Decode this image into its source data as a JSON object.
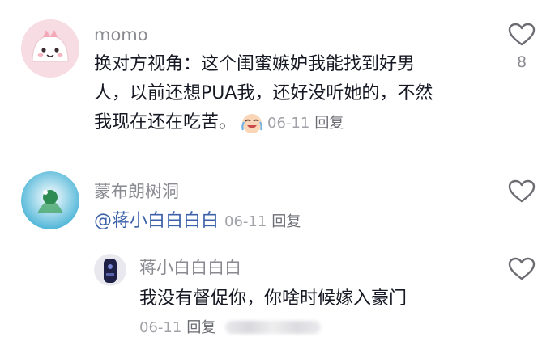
{
  "comments": [
    {
      "username": "momo",
      "lines": [
        "换对方视角：这个闺蜜嫉妒我能找到好男",
        "人，以前还想PUA我，还好没听她的，不然",
        "我现在还在吃苦。"
      ],
      "emoji": "crying-laughing-emoji",
      "date": "06-11",
      "reply_label": "回复",
      "like_count": "8"
    },
    {
      "username": "蒙布朗树洞",
      "mention": "@蒋小白白白白",
      "date": "06-11",
      "reply_label": "回复"
    },
    {
      "username": "蒋小白白白白",
      "text": "我没有督促你，你啥时候嫁入豪门",
      "date": "06-11",
      "reply_label": "回复"
    }
  ],
  "colors": {
    "username": "#8a8b91",
    "mention": "#3c61a8",
    "meta": "#a1a2a8",
    "text": "#161823"
  }
}
